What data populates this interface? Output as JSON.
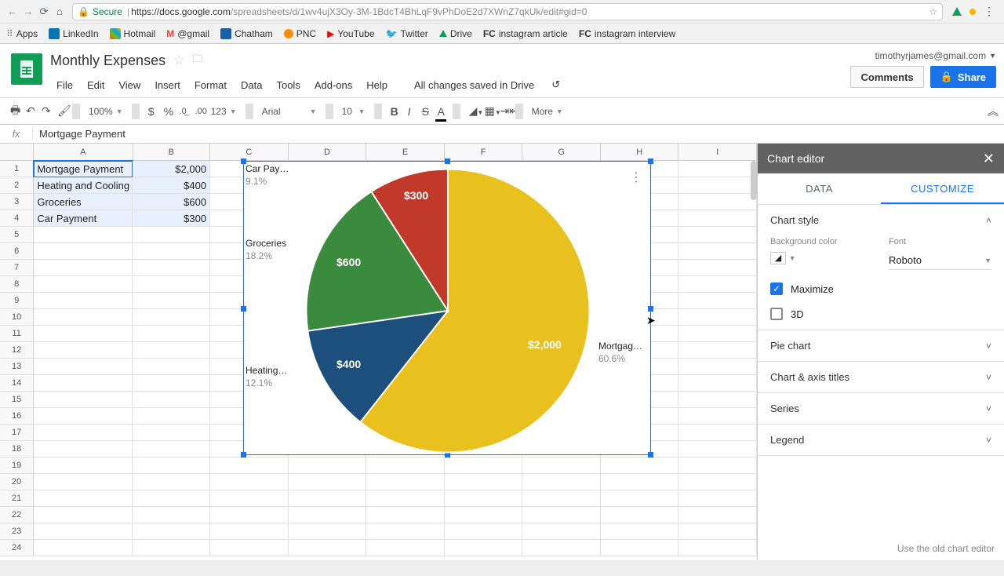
{
  "browser": {
    "secure_label": "Secure",
    "url_host": "https://docs.google.com",
    "url_path": "/spreadsheets/d/1wv4ujX3Oy-3M-1BdcT4BhLqF9vPhDoE2d7XWnZ7qkUk/edit#gid=0"
  },
  "bookmarks": [
    {
      "label": "Apps",
      "color": "#888"
    },
    {
      "label": "LinkedIn",
      "color": "#0077b5"
    },
    {
      "label": "Hotmail",
      "color": "#ff6a00"
    },
    {
      "label": "@gmail",
      "color": "#ea4335"
    },
    {
      "label": "Chatham",
      "color": "#1b5fa6"
    },
    {
      "label": "PNC",
      "color": "#ff8a00"
    },
    {
      "label": "YouTube",
      "color": "#ff0000"
    },
    {
      "label": "Twitter",
      "color": "#1da1f2"
    },
    {
      "label": "Drive",
      "color": "#0f9d58"
    },
    {
      "label": "instagram article",
      "color": "#333"
    },
    {
      "label": "instagram interview",
      "color": "#333"
    }
  ],
  "doc": {
    "title": "Monthly Expenses",
    "account": "timothyrjames@gmail.com",
    "comments_btn": "Comments",
    "share_btn": "Share",
    "menus": [
      "File",
      "Edit",
      "View",
      "Insert",
      "Format",
      "Data",
      "Tools",
      "Add-ons",
      "Help"
    ],
    "saved_text": "All changes saved in Drive"
  },
  "toolbar": {
    "zoom": "100%",
    "font": "Arial",
    "font_size": "10",
    "more": "More"
  },
  "formula_bar": {
    "fx": "fx",
    "value": "Mortgage Payment"
  },
  "grid": {
    "col_widths": {
      "A": 128,
      "B": 100,
      "other": 101
    },
    "columns": [
      "A",
      "B",
      "C",
      "D",
      "E",
      "F",
      "G",
      "H",
      "I"
    ],
    "rows": 24,
    "data": [
      {
        "a": "Mortgage Payment",
        "b": "$2,000"
      },
      {
        "a": "Heating and Cooling",
        "b": "$400"
      },
      {
        "a": "Groceries",
        "b": "$600"
      },
      {
        "a": "Car Payment",
        "b": "$300"
      }
    ]
  },
  "chart_data": {
    "type": "pie",
    "categories": [
      "Mortgage Payment",
      "Heating and Cooling",
      "Groceries",
      "Car Payment"
    ],
    "values": [
      2000,
      400,
      600,
      300
    ],
    "percentages": [
      60.6,
      12.1,
      18.2,
      9.1
    ],
    "value_labels": [
      "$2,000",
      "$400",
      "$600",
      "$300"
    ],
    "short_labels": [
      "Mortgag…",
      "Heating…",
      "Groceries",
      "Car Pay…"
    ],
    "colors": [
      "#e8c11e",
      "#1c4f7c",
      "#3b8b3e",
      "#c0392b"
    ],
    "title": "",
    "legend": "labeled"
  },
  "chart_editor": {
    "title": "Chart editor",
    "tabs": [
      "DATA",
      "CUSTOMIZE"
    ],
    "active_tab": 1,
    "sections": {
      "chart_style": {
        "title": "Chart style",
        "bg_label": "Background color",
        "font_label": "Font",
        "font_value": "Roboto",
        "maximize": "Maximize",
        "threed": "3D"
      },
      "pie_chart": "Pie chart",
      "titles": "Chart & axis titles",
      "series": "Series",
      "legend": "Legend"
    },
    "footer": "Use the old chart editor"
  }
}
